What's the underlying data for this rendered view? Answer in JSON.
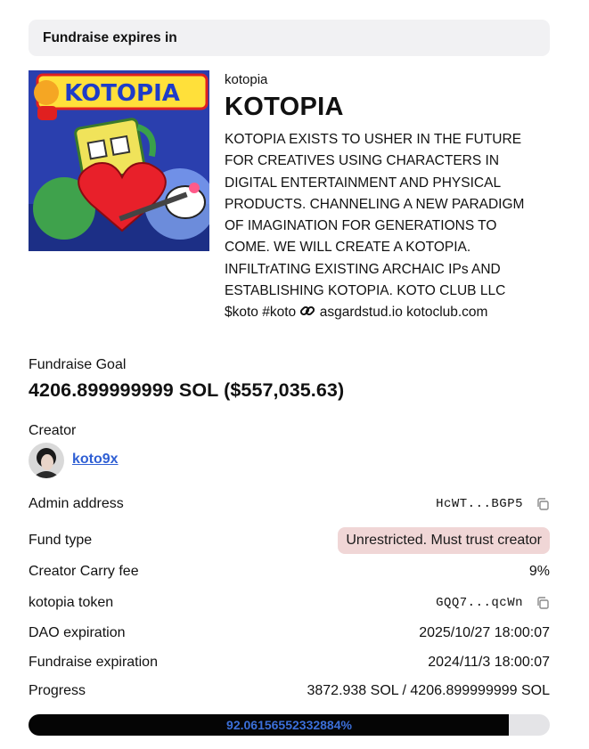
{
  "expires": {
    "label": "Fundraise expires in"
  },
  "project": {
    "slug": "kotopia",
    "name": "KOTOPIA",
    "cover_text": "KOTOPIA",
    "description_lines": [
      "KOTOPIA EXISTS TO USHER IN THE FUTURE",
      "FOR CREATIVES USING CHARACTERS IN",
      "DIGITAL ENTERTAINMENT AND PHYSICAL",
      "PRODUCTS. CHANNELING A NEW PARADIGM",
      "OF IMAGINATION FOR GENERATIONS TO",
      "COME. WE WILL CREATE A KOTOPIA.",
      "INFILTrATING EXISTING ARCHAIC IPs AND",
      "ESTABLISHING KOTOPIA. KOTO CLUB LLC"
    ],
    "tags": "$koto #koto",
    "link_icon": "link-icon",
    "links": "asgardstud.io kotoclub.com"
  },
  "goal": {
    "label": "Fundraise Goal",
    "value": "4206.899999999 SOL ($557,035.63)"
  },
  "creator": {
    "label": "Creator",
    "name": "koto9x"
  },
  "details": {
    "admin_label": "Admin address",
    "admin_value": "HcWT...BGP5",
    "fund_type_label": "Fund type",
    "fund_type_value": "Unrestricted. Must trust creator",
    "carry_label": "Creator Carry fee",
    "carry_value": "9%",
    "token_label": "kotopia token",
    "token_value": "GQQ7...qcWn",
    "dao_exp_label": "DAO expiration",
    "dao_exp_value": "2025/10/27 18:00:07",
    "fund_exp_label": "Fundraise expiration",
    "fund_exp_value": "2024/11/3 18:00:07",
    "progress_label": "Progress",
    "progress_value": "3872.938 SOL / 4206.899999999 SOL"
  },
  "progress": {
    "percent_text": "92.06156552332884%",
    "fraction": 0.9206156552332884
  },
  "colors": {
    "accent_link": "#2f5fd4",
    "badge_bg": "#f0d6d6",
    "bar_fill": "#050505",
    "bar_text": "#3b6fd9"
  }
}
